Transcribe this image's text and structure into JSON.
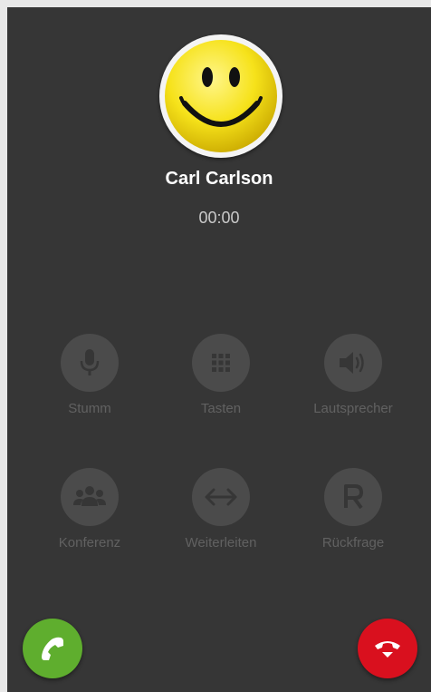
{
  "call": {
    "caller_name": "Carl Carlson",
    "duration": "00:00"
  },
  "controls": [
    {
      "label": "Stumm",
      "icon": "microphone-icon"
    },
    {
      "label": "Tasten",
      "icon": "dialpad-icon"
    },
    {
      "label": "Lautsprecher",
      "icon": "speaker-icon"
    },
    {
      "label": "Konferenz",
      "icon": "group-icon"
    },
    {
      "label": "Weiterleiten",
      "icon": "transfer-icon"
    },
    {
      "label": "Rückfrage",
      "icon": "r-letter-icon"
    }
  ],
  "actions": {
    "accept_icon": "phone-icon",
    "hangup_icon": "hangup-icon"
  },
  "colors": {
    "background": "#363636",
    "control_circle": "#4b4b4b",
    "control_label": "#616161",
    "accept": "#5fae2e",
    "hangup": "#d9101e"
  }
}
